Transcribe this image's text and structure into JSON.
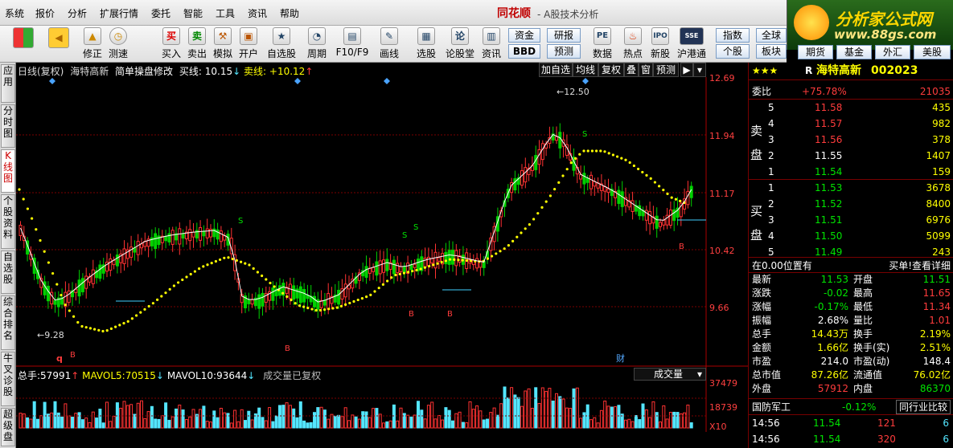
{
  "menu": {
    "items": [
      "系统",
      "报价",
      "分析",
      "扩展行情",
      "委托",
      "智能",
      "工具",
      "资讯",
      "帮助"
    ],
    "app_title": "同花顺",
    "app_subtitle": "- A股技术分析"
  },
  "logo": {
    "line1": "分析家公式网",
    "line2": "www.88gs.com"
  },
  "toolbar": {
    "items": [
      {
        "label": "",
        "icon": "panel-icon"
      },
      {
        "label": "",
        "icon": "back-arrow-icon"
      },
      {
        "label": "修正",
        "icon": "up-arrow-icon"
      },
      {
        "label": "测速",
        "icon": "clock-icon"
      },
      {
        "label": "买入",
        "icon": "buy-icon",
        "glyph": "买"
      },
      {
        "label": "卖出",
        "icon": "sell-icon",
        "glyph": "卖"
      },
      {
        "label": "模拟",
        "icon": "hammer-icon"
      },
      {
        "label": "开户",
        "icon": "lock-icon"
      },
      {
        "label": "自选股",
        "icon": "star-icon"
      },
      {
        "label": "周期",
        "icon": "cycle-icon"
      },
      {
        "label": "F10/F9",
        "icon": "f10-icon"
      },
      {
        "label": "画线",
        "icon": "pen-icon"
      },
      {
        "label": "选股",
        "icon": "select-icon"
      },
      {
        "label": "论股堂",
        "icon": "forum-icon",
        "glyph": "论"
      },
      {
        "label": "资讯",
        "icon": "news-icon"
      },
      {
        "label": "数据",
        "icon": "pe-icon",
        "glyph": "PE"
      },
      {
        "label": "热点",
        "icon": "hot-icon"
      },
      {
        "label": "新股",
        "icon": "ipo-icon"
      },
      {
        "label": "沪港通",
        "icon": "sse-hke-icon"
      }
    ],
    "small": [
      "资金",
      "BBD",
      "研报",
      "预测"
    ],
    "right_small": [
      "指数",
      "全球",
      "个股",
      "板块"
    ],
    "right_tabs": [
      "期货",
      "基金",
      "外汇",
      "美股"
    ]
  },
  "lefttabs": [
    "应用",
    "分时图",
    "K线图",
    "个股资料",
    "自选股",
    "综合排名",
    "牛叉诊股",
    "超级盘"
  ],
  "chart_header": {
    "title": "日线(复权)",
    "name": "海特高新",
    "formula": "简单操盘修改",
    "buy_label": "买线:",
    "buy_val": "10.15",
    "sell_label": "卖线:",
    "sell_val": "+10.12"
  },
  "chart_buttons": [
    "加自选",
    "均线",
    "复权",
    "叠",
    "窗",
    "预测"
  ],
  "price_axis": [
    "12.69",
    "11.94",
    "11.17",
    "10.42",
    "9.66"
  ],
  "markers": {
    "high": "12.50",
    "low": "9.28",
    "s": "S",
    "b": "B",
    "q": "q",
    "cai": "财"
  },
  "volume_header": {
    "total_label": "总手:",
    "total": "57991",
    "ma5_label": "MAVOL5:",
    "ma5": "70515",
    "ma10_label": "MAVOL10:",
    "ma10": "93644",
    "note": "成交量已复权",
    "dropdown": "成交量"
  },
  "volume_axis": [
    "37479",
    "18739",
    "X10"
  ],
  "stock": {
    "stars": "★★★",
    "flag": "R",
    "name": "海特高新",
    "code": "002023"
  },
  "weibi": {
    "label": "委比",
    "pct": "+75.78%",
    "val": "21035"
  },
  "sell_label": "卖盘",
  "buy_label": "买盘",
  "asks": [
    {
      "lvl": "5",
      "price": "11.58",
      "vol": "435"
    },
    {
      "lvl": "4",
      "price": "11.57",
      "vol": "982"
    },
    {
      "lvl": "3",
      "price": "11.56",
      "vol": "378"
    },
    {
      "lvl": "2",
      "price": "11.55",
      "vol": "1407"
    },
    {
      "lvl": "1",
      "price": "11.54",
      "vol": "159"
    }
  ],
  "bids": [
    {
      "lvl": "1",
      "price": "11.53",
      "vol": "3678"
    },
    {
      "lvl": "2",
      "price": "11.52",
      "vol": "8400"
    },
    {
      "lvl": "3",
      "price": "11.51",
      "vol": "6976"
    },
    {
      "lvl": "4",
      "price": "11.50",
      "vol": "5099"
    },
    {
      "lvl": "5",
      "price": "11.49",
      "vol": "243"
    }
  ],
  "position_info": {
    "left": "在0.00位置有",
    "right": "买单!查看详细"
  },
  "quotes": [
    {
      "l1": "最新",
      "v1": "11.53",
      "l2": "开盘",
      "v2": "11.51"
    },
    {
      "l1": "涨跌",
      "v1": "-0.02",
      "l2": "最高",
      "v2": "11.65"
    },
    {
      "l1": "涨幅",
      "v1": "-0.17%",
      "l2": "最低",
      "v2": "11.34"
    },
    {
      "l1": "振幅",
      "v1": "2.68%",
      "l2": "量比",
      "v2": "1.01"
    },
    {
      "l1": "总手",
      "v1": "14.43万",
      "l2": "换手",
      "v2": "2.19%"
    },
    {
      "l1": "金额",
      "v1": "1.66亿",
      "l2": "换手(实)",
      "v2": "2.51%"
    },
    {
      "l1": "市盈",
      "v1": "214.0",
      "l2": "市盈(动)",
      "v2": "148.4"
    },
    {
      "l1": "总市值",
      "v1": "87.26亿",
      "l2": "流通值",
      "v2": "76.02亿"
    },
    {
      "l1": "外盘",
      "v1": "57912",
      "l2": "内盘",
      "v2": "86370"
    }
  ],
  "sector": {
    "name": "国防军工",
    "pct": "-0.12%",
    "compare": "同行业比较"
  },
  "ticks": [
    {
      "time": "14:56",
      "price": "11.54",
      "vol": "121",
      "n": "6"
    },
    {
      "time": "14:56",
      "price": "11.54",
      "vol": "320",
      "n": "6"
    }
  ]
}
